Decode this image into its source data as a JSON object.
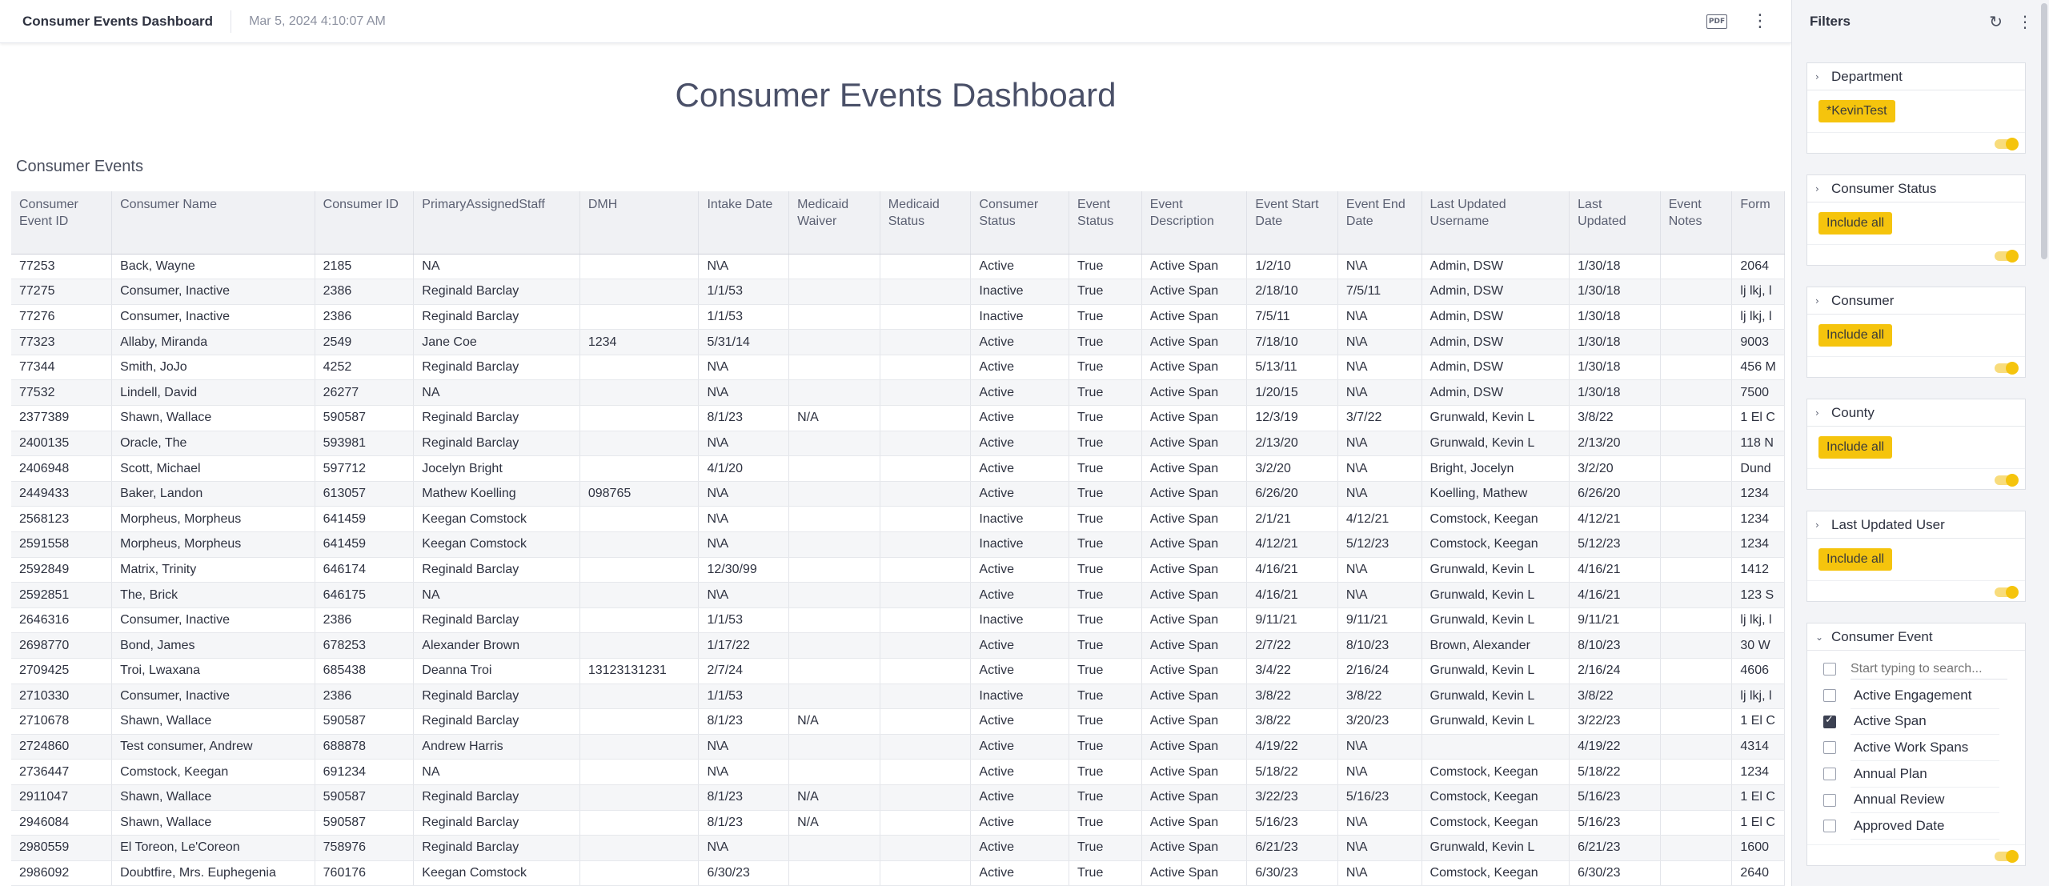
{
  "topbar": {
    "title": "Consumer Events Dashboard",
    "timestamp": "Mar 5, 2024 4:10:07 AM",
    "pdf_icon": "pdf-icon",
    "more_icon": "more-vertical-icon",
    "pdf_label": "PDF"
  },
  "dashboard": {
    "title": "Consumer Events Dashboard",
    "section_title": "Consumer Events"
  },
  "table": {
    "columns": [
      "Consumer Event ID",
      "Consumer Name",
      "Consumer ID",
      "PrimaryAssignedStaff",
      "DMH",
      "Intake Date",
      "Medicaid Waiver",
      "Medicaid Status",
      "Consumer Status",
      "Event Status",
      "Event Description",
      "Event Start Date",
      "Event End Date",
      "Last Updated Username",
      "Last Updated",
      "Event Notes",
      "Form"
    ],
    "rows": [
      [
        "77253",
        "Back, Wayne",
        "2185",
        "NA",
        "",
        "N\\A",
        "",
        "",
        "Active",
        "True",
        "Active Span",
        "1/2/10",
        "N\\A",
        "Admin, DSW",
        "1/30/18",
        "",
        "2064"
      ],
      [
        "77275",
        "Consumer, Inactive",
        "2386",
        "Reginald Barclay",
        "",
        "1/1/53",
        "",
        "",
        "Inactive",
        "True",
        "Active Span",
        "2/18/10",
        "7/5/11",
        "Admin, DSW",
        "1/30/18",
        "",
        "lj lkj, l"
      ],
      [
        "77276",
        "Consumer, Inactive",
        "2386",
        "Reginald Barclay",
        "",
        "1/1/53",
        "",
        "",
        "Inactive",
        "True",
        "Active Span",
        "7/5/11",
        "N\\A",
        "Admin, DSW",
        "1/30/18",
        "",
        "lj lkj, l"
      ],
      [
        "77323",
        "Allaby, Miranda",
        "2549",
        "Jane Coe",
        "1234",
        "5/31/14",
        "",
        "",
        "Active",
        "True",
        "Active Span",
        "7/18/10",
        "N\\A",
        "Admin, DSW",
        "1/30/18",
        "",
        "9003"
      ],
      [
        "77344",
        "Smith, JoJo",
        "4252",
        "Reginald Barclay",
        "",
        "N\\A",
        "",
        "",
        "Active",
        "True",
        "Active Span",
        "5/13/11",
        "N\\A",
        "Admin, DSW",
        "1/30/18",
        "",
        "456 M"
      ],
      [
        "77532",
        "Lindell, David",
        "26277",
        "NA",
        "",
        "N\\A",
        "",
        "",
        "Active",
        "True",
        "Active Span",
        "1/20/15",
        "N\\A",
        "Admin, DSW",
        "1/30/18",
        "",
        "7500"
      ],
      [
        "2377389",
        "Shawn, Wallace",
        "590587",
        "Reginald Barclay",
        "",
        "8/1/23",
        "N/A",
        "",
        "Active",
        "True",
        "Active Span",
        "12/3/19",
        "3/7/22",
        "Grunwald, Kevin L",
        "3/8/22",
        "",
        "1 El C"
      ],
      [
        "2400135",
        "Oracle, The",
        "593981",
        "Reginald Barclay",
        "",
        "N\\A",
        "",
        "",
        "Active",
        "True",
        "Active Span",
        "2/13/20",
        "N\\A",
        "Grunwald, Kevin L",
        "2/13/20",
        "",
        "118 N"
      ],
      [
        "2406948",
        "Scott, Michael",
        "597712",
        "Jocelyn Bright",
        "",
        "4/1/20",
        "",
        "",
        "Active",
        "True",
        "Active Span",
        "3/2/20",
        "N\\A",
        "Bright, Jocelyn",
        "3/2/20",
        "",
        "Dund"
      ],
      [
        "2449433",
        "Baker, Landon",
        "613057",
        "Mathew Koelling",
        "098765",
        "N\\A",
        "",
        "",
        "Active",
        "True",
        "Active Span",
        "6/26/20",
        "N\\A",
        "Koelling, Mathew",
        "6/26/20",
        "",
        "1234"
      ],
      [
        "2568123",
        "Morpheus, Morpheus",
        "641459",
        "Keegan Comstock",
        "",
        "N\\A",
        "",
        "",
        "Inactive",
        "True",
        "Active Span",
        "2/1/21",
        "4/12/21",
        "Comstock, Keegan",
        "4/12/21",
        "",
        "1234"
      ],
      [
        "2591558",
        "Morpheus, Morpheus",
        "641459",
        "Keegan Comstock",
        "",
        "N\\A",
        "",
        "",
        "Inactive",
        "True",
        "Active Span",
        "4/12/21",
        "5/12/23",
        "Comstock, Keegan",
        "5/12/23",
        "",
        "1234"
      ],
      [
        "2592849",
        "Matrix, Trinity",
        "646174",
        "Reginald Barclay",
        "",
        "12/30/99",
        "",
        "",
        "Active",
        "True",
        "Active Span",
        "4/16/21",
        "N\\A",
        "Grunwald, Kevin L",
        "4/16/21",
        "",
        "1412"
      ],
      [
        "2592851",
        "The, Brick",
        "646175",
        "NA",
        "",
        "N\\A",
        "",
        "",
        "Active",
        "True",
        "Active Span",
        "4/16/21",
        "N\\A",
        "Grunwald, Kevin L",
        "4/16/21",
        "",
        "123 S"
      ],
      [
        "2646316",
        "Consumer, Inactive",
        "2386",
        "Reginald Barclay",
        "",
        "1/1/53",
        "",
        "",
        "Inactive",
        "True",
        "Active Span",
        "9/11/21",
        "9/11/21",
        "Grunwald, Kevin L",
        "9/11/21",
        "",
        "lj lkj, l"
      ],
      [
        "2698770",
        "Bond, James",
        "678253",
        "Alexander Brown",
        "",
        "1/17/22",
        "",
        "",
        "Active",
        "True",
        "Active Span",
        "2/7/22",
        "8/10/23",
        "Brown, Alexander",
        "8/10/23",
        "",
        "30 W"
      ],
      [
        "2709425",
        "Troi, Lwaxana",
        "685438",
        "Deanna Troi",
        "13123131231",
        "2/7/24",
        "",
        "",
        "Active",
        "True",
        "Active Span",
        "3/4/22",
        "2/16/24",
        "Grunwald, Kevin L",
        "2/16/24",
        "",
        "4606"
      ],
      [
        "2710330",
        "Consumer, Inactive",
        "2386",
        "Reginald Barclay",
        "",
        "1/1/53",
        "",
        "",
        "Inactive",
        "True",
        "Active Span",
        "3/8/22",
        "3/8/22",
        "Grunwald, Kevin L",
        "3/8/22",
        "",
        "lj lkj, l"
      ],
      [
        "2710678",
        "Shawn, Wallace",
        "590587",
        "Reginald Barclay",
        "",
        "8/1/23",
        "N/A",
        "",
        "Active",
        "True",
        "Active Span",
        "3/8/22",
        "3/20/23",
        "Grunwald, Kevin L",
        "3/22/23",
        "",
        "1 El C"
      ],
      [
        "2724860",
        "Test consumer, Andrew",
        "688878",
        "Andrew Harris",
        "",
        "N\\A",
        "",
        "",
        "Active",
        "True",
        "Active Span",
        "4/19/22",
        "N\\A",
        "",
        "4/19/22",
        "",
        "4314"
      ],
      [
        "2736447",
        "Comstock, Keegan",
        "691234",
        "NA",
        "",
        "N\\A",
        "",
        "",
        "Active",
        "True",
        "Active Span",
        "5/18/22",
        "N\\A",
        "Comstock, Keegan",
        "5/18/22",
        "",
        "1234"
      ],
      [
        "2911047",
        "Shawn, Wallace",
        "590587",
        "Reginald Barclay",
        "",
        "8/1/23",
        "N/A",
        "",
        "Active",
        "True",
        "Active Span",
        "3/22/23",
        "5/16/23",
        "Comstock, Keegan",
        "5/16/23",
        "",
        "1 El C"
      ],
      [
        "2946084",
        "Shawn, Wallace",
        "590587",
        "Reginald Barclay",
        "",
        "8/1/23",
        "N/A",
        "",
        "Active",
        "True",
        "Active Span",
        "5/16/23",
        "N\\A",
        "Comstock, Keegan",
        "5/16/23",
        "",
        "1 El C"
      ],
      [
        "2980559",
        "El Toreon, Le'Coreon",
        "758976",
        "Reginald Barclay",
        "",
        "N\\A",
        "",
        "",
        "Active",
        "True",
        "Active Span",
        "6/21/23",
        "N\\A",
        "Grunwald, Kevin L",
        "6/21/23",
        "",
        "1600"
      ],
      [
        "2986092",
        "Doubtfire, Mrs. Euphegenia",
        "760176",
        "Keegan Comstock",
        "",
        "6/30/23",
        "",
        "",
        "Active",
        "True",
        "Active Span",
        "6/30/23",
        "N\\A",
        "Comstock, Keegan",
        "6/30/23",
        "",
        "2640"
      ]
    ]
  },
  "filters": {
    "title": "Filters",
    "reset_icon": "reset-icon",
    "more_icon": "more-vertical-icon",
    "groups": [
      {
        "label": "Department",
        "chip": "*KevinTest"
      },
      {
        "label": "Consumer Status",
        "chip": "Include all"
      },
      {
        "label": "Consumer",
        "chip": "Include all"
      },
      {
        "label": "County",
        "chip": "Include all"
      },
      {
        "label": "Last Updated User",
        "chip": "Include all"
      }
    ],
    "consumer_event": {
      "label": "Consumer Event",
      "search_placeholder": "Start typing to search...",
      "options": [
        {
          "label": "Active Engagement",
          "checked": false
        },
        {
          "label": "Active Span",
          "checked": true
        },
        {
          "label": "Active Work Spans",
          "checked": false
        },
        {
          "label": "Annual Plan",
          "checked": false
        },
        {
          "label": "Annual Review",
          "checked": false
        },
        {
          "label": "Approved Date",
          "checked": false
        }
      ]
    },
    "colors": {
      "chip": "#f5c40d",
      "panel_bg": "#f3f4f7"
    }
  }
}
